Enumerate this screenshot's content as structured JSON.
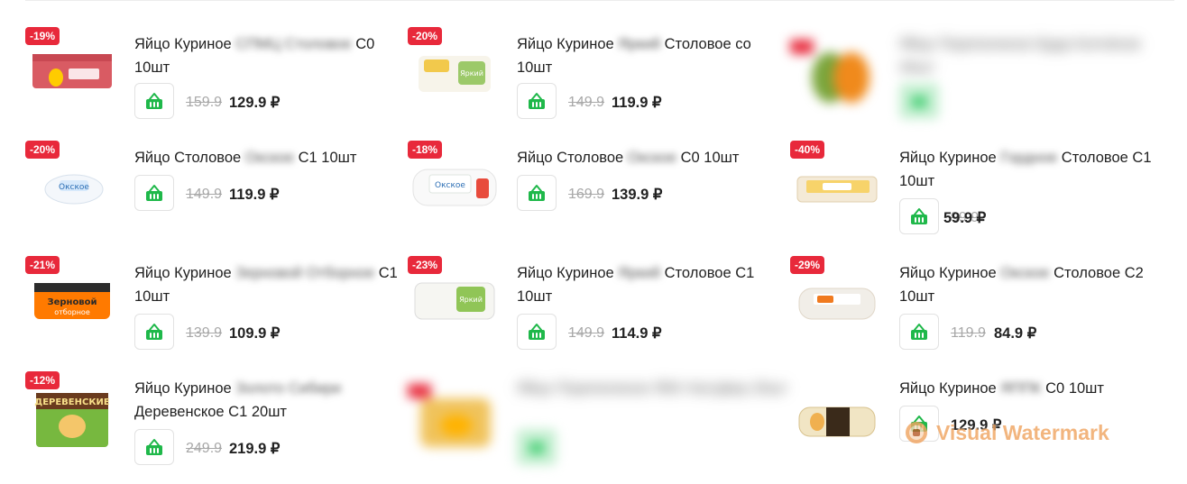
{
  "currency": "₽",
  "colors": {
    "badge": "#e8293b",
    "basket": "#1fb84a",
    "old_price": "#a8a8a8",
    "watermark": "#f0a562"
  },
  "products": [
    {
      "id": "c1",
      "discount": "-19%",
      "title_start": "Яйцо Куриное",
      "title_blur": "СПМЦ Столовое",
      "title_end": "С0 10шт",
      "old_price": "159.9",
      "new_price": "129.9 ₽",
      "image": "pack-brown-red"
    },
    {
      "id": "c2",
      "discount": "-20%",
      "title_start": "Яйцо Куриное",
      "title_blur": "Яркий",
      "title_end": "Столовое со 10шт",
      "old_price": "149.9",
      "new_price": "119.9 ₽",
      "image": "pack-white-green"
    },
    {
      "id": "c3",
      "discount": "",
      "title_start": "",
      "title_blur": "Яйцо Перепелиное Брда Копчёное 40шт",
      "title_end": "",
      "old_price": "",
      "new_price": "",
      "image": "pack-orange-green",
      "blurred": true
    },
    {
      "id": "c4",
      "discount": "-20%",
      "title_start": "Яйцо Столовое",
      "title_blur": "Окское",
      "title_end": "С1 10шт",
      "old_price": "149.9",
      "new_price": "119.9 ₽",
      "image": "pack-white-blue"
    },
    {
      "id": "c5",
      "discount": "-18%",
      "title_start": "Яйцо Столовое",
      "title_blur": "Окское",
      "title_end": "С0 10шт",
      "old_price": "169.9",
      "new_price": "139.9 ₽",
      "image": "pack-white-green-red"
    },
    {
      "id": "c6",
      "discount": "-40%",
      "title_start": "Яйцо Куриное",
      "title_blur": "Гордное",
      "title_end": "Столовое С1 10шт",
      "old_price": "99.9",
      "new_price": "59.9 ₽",
      "image": "pack-open-yellow"
    },
    {
      "id": "c7",
      "discount": "-21%",
      "title_start": "Яйцо Куриное",
      "title_blur": "Зерновой Отборное",
      "title_end": "С1 10шт",
      "old_price": "139.9",
      "new_price": "109.9 ₽",
      "image": "pack-orange-dark"
    },
    {
      "id": "c8",
      "discount": "-23%",
      "title_start": "Яйцо Куриное",
      "title_blur": "Яркий",
      "title_end": "Столовое С1 10шт",
      "old_price": "149.9",
      "new_price": "114.9 ₽",
      "image": "pack-white-green"
    },
    {
      "id": "c9",
      "discount": "-29%",
      "title_start": "Яйцо Куриное",
      "title_blur": "Окское",
      "title_end": "Столовое С2 10шт",
      "old_price": "119.9",
      "new_price": "84.9 ₽",
      "image": "pack-beige-orange"
    },
    {
      "id": "c10",
      "discount": "-12%",
      "title_start": "Яйцо Куриное",
      "title_blur": "Золото Сибири",
      "title_end": "Деревенское С1 20шт",
      "old_price": "249.9",
      "new_price": "219.9 ₽",
      "image": "pack-green-yellow"
    },
    {
      "id": "c11",
      "discount": "",
      "title_start": "",
      "title_blur": "Яйцо Перепелиное ЯКК Натуфер 20шт",
      "title_end": "",
      "old_price": "",
      "new_price": "",
      "image": "pack-yellow-blurred",
      "blurred": true
    },
    {
      "id": "c12",
      "discount": "",
      "title_start": "Яйцо Куриное",
      "title_blur": "ЯППК",
      "title_end": "С0 10шт",
      "old_price": "",
      "new_price": "129.9 ₽",
      "image": "pack-gold-dark"
    }
  ],
  "watermark": {
    "text": "Visual Watermark",
    "icon": "watermark-logo-icon"
  }
}
